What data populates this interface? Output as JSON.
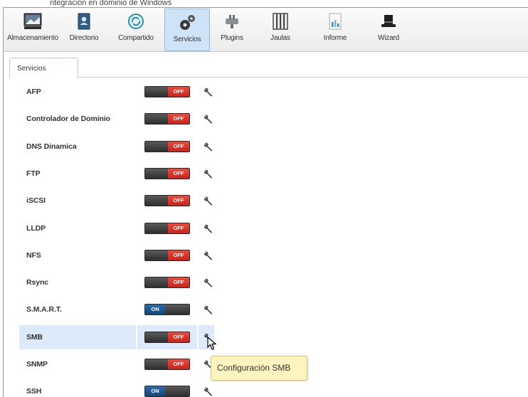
{
  "top_text": "ntegración en dominio de Windows",
  "toolbar": {
    "items": [
      {
        "label": "Almacenamiento",
        "icon": "storage-icon"
      },
      {
        "label": "Directorio",
        "icon": "directory-icon"
      },
      {
        "label": "Compartido",
        "icon": "sharing-icon"
      },
      {
        "label": "Servicios",
        "icon": "services-icon",
        "active": true
      },
      {
        "label": "Plugins",
        "icon": "plugins-icon"
      },
      {
        "label": "Jaulas",
        "icon": "jails-icon"
      },
      {
        "label": "Informe",
        "icon": "report-icon"
      },
      {
        "label": "Wizard",
        "icon": "wizard-icon"
      }
    ]
  },
  "tab": {
    "label": "Servicios"
  },
  "toggle_labels": {
    "on": "ON",
    "off": "OFF"
  },
  "services": [
    {
      "name": "AFP",
      "state": "off"
    },
    {
      "name": "Controlador de Dominio",
      "state": "off"
    },
    {
      "name": "DNS Dinamica",
      "state": "off"
    },
    {
      "name": "FTP",
      "state": "off"
    },
    {
      "name": "iSCSI",
      "state": "off"
    },
    {
      "name": "LLDP",
      "state": "off"
    },
    {
      "name": "NFS",
      "state": "off"
    },
    {
      "name": "Rsync",
      "state": "off"
    },
    {
      "name": "S.M.A.R.T.",
      "state": "on"
    },
    {
      "name": "SMB",
      "state": "off",
      "selected": true
    },
    {
      "name": "SNMP",
      "state": "off"
    },
    {
      "name": "SSH",
      "state": "on"
    }
  ],
  "tooltip": {
    "text": "Configuración SMB"
  },
  "colors": {
    "off": "#d9261c",
    "on": "#1a5288",
    "selected_row": "#dceafb",
    "tooltip_bg": "#fdf4bf"
  }
}
